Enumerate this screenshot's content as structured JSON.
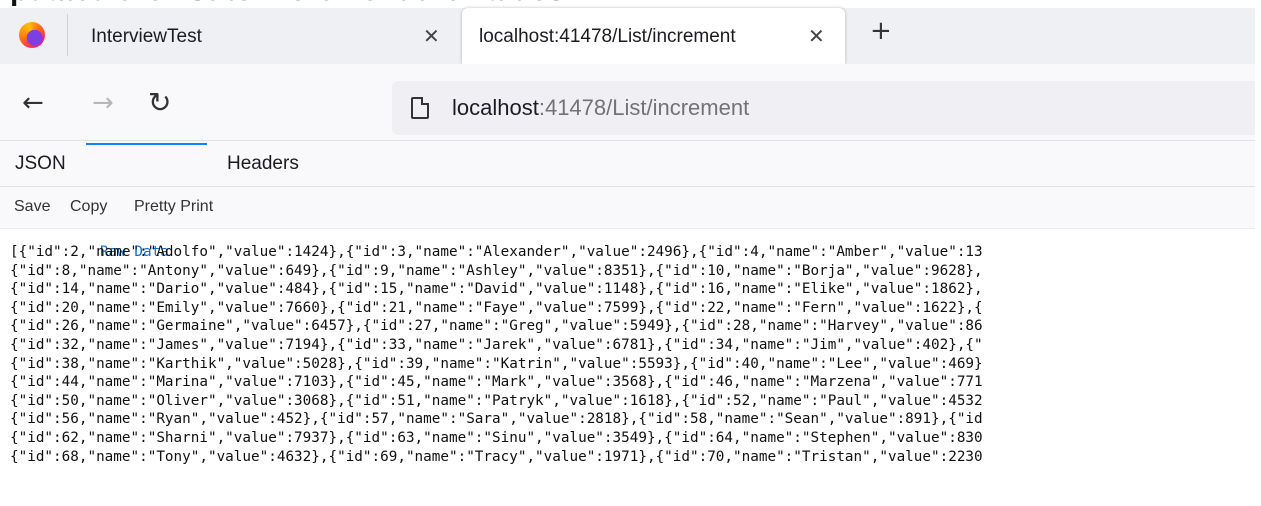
{
  "top_heading_text": "pdated the list to increment the values",
  "tabs": [
    {
      "title": "InterviewTest",
      "close_glyph": "✕"
    },
    {
      "title": "localhost:41478/List/increment",
      "close_glyph": "✕"
    }
  ],
  "new_tab_glyph": "+",
  "nav": {
    "back_glyph": "←",
    "forward_glyph": "→",
    "reload_glyph": "↻",
    "url_host": "localhost",
    "url_rest": ":41478/List/increment"
  },
  "viewer_tabs": {
    "json": "JSON",
    "raw": "Raw Data",
    "headers": "Headers"
  },
  "toolbar": {
    "save": "Save",
    "copy": "Copy",
    "pretty": "Pretty Print"
  },
  "raw_lines": [
    "[{\"id\":2,\"name\":\"Adolfo\",\"value\":1424},{\"id\":3,\"name\":\"Alexander\",\"value\":2496},{\"id\":4,\"name\":\"Amber\",\"value\":13",
    "{\"id\":8,\"name\":\"Antony\",\"value\":649},{\"id\":9,\"name\":\"Ashley\",\"value\":8351},{\"id\":10,\"name\":\"Borja\",\"value\":9628},",
    "{\"id\":14,\"name\":\"Dario\",\"value\":484},{\"id\":15,\"name\":\"David\",\"value\":1148},{\"id\":16,\"name\":\"Elike\",\"value\":1862},",
    "{\"id\":20,\"name\":\"Emily\",\"value\":7660},{\"id\":21,\"name\":\"Faye\",\"value\":7599},{\"id\":22,\"name\":\"Fern\",\"value\":1622},{",
    "{\"id\":26,\"name\":\"Germaine\",\"value\":6457},{\"id\":27,\"name\":\"Greg\",\"value\":5949},{\"id\":28,\"name\":\"Harvey\",\"value\":86",
    "{\"id\":32,\"name\":\"James\",\"value\":7194},{\"id\":33,\"name\":\"Jarek\",\"value\":6781},{\"id\":34,\"name\":\"Jim\",\"value\":402},{\"",
    "{\"id\":38,\"name\":\"Karthik\",\"value\":5028},{\"id\":39,\"name\":\"Katrin\",\"value\":5593},{\"id\":40,\"name\":\"Lee\",\"value\":469}",
    "{\"id\":44,\"name\":\"Marina\",\"value\":7103},{\"id\":45,\"name\":\"Mark\",\"value\":3568},{\"id\":46,\"name\":\"Marzena\",\"value\":771",
    "{\"id\":50,\"name\":\"Oliver\",\"value\":3068},{\"id\":51,\"name\":\"Patryk\",\"value\":1618},{\"id\":52,\"name\":\"Paul\",\"value\":4532",
    "{\"id\":56,\"name\":\"Ryan\",\"value\":452},{\"id\":57,\"name\":\"Sara\",\"value\":2818},{\"id\":58,\"name\":\"Sean\",\"value\":891},{\"id",
    "{\"id\":62,\"name\":\"Sharni\",\"value\":7937},{\"id\":63,\"name\":\"Sinu\",\"value\":3549},{\"id\":64,\"name\":\"Stephen\",\"value\":830",
    "{\"id\":68,\"name\":\"Tony\",\"value\":4632},{\"id\":69,\"name\":\"Tracy\",\"value\":1971},{\"id\":70,\"name\":\"Tristan\",\"value\":2230"
  ]
}
